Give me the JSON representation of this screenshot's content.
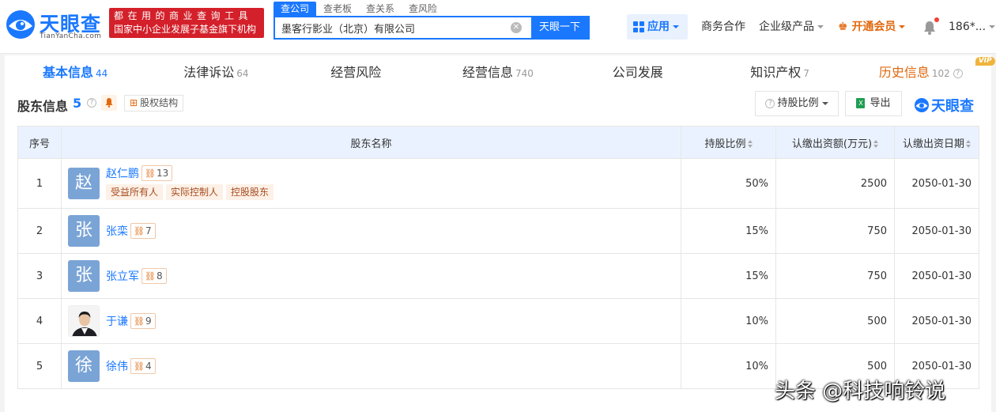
{
  "brand": {
    "name_cn": "天眼查",
    "name_en": "TianYanCha.com",
    "color": "#1a78ff"
  },
  "slogan": {
    "line1": "都在用的商业查询工具",
    "line2": "国家中小企业发展子基金旗下机构"
  },
  "search": {
    "tabs": [
      "查公司",
      "查老板",
      "查关系",
      "查风险"
    ],
    "value": "墨客行影业（北京）有限公司",
    "button": "天眼一下"
  },
  "nav": {
    "apps": "应用",
    "business": "商务合作",
    "enterprise": "企业级产品",
    "vip": "开通会员",
    "user": "186*..."
  },
  "tabs": [
    {
      "label": "基本信息",
      "count": "44"
    },
    {
      "label": "法律诉讼",
      "count": "64"
    },
    {
      "label": "经营风险",
      "count": ""
    },
    {
      "label": "经营信息",
      "count": "740"
    },
    {
      "label": "公司发展",
      "count": ""
    },
    {
      "label": "知识产权",
      "count": "7"
    },
    {
      "label": "历史信息",
      "count": "102",
      "badge": "VIP"
    }
  ],
  "section": {
    "title": "股东信息",
    "count": "5",
    "equity_button": "股权结构",
    "ratio_button": "持股比例",
    "export_button": "导出",
    "watermark_logo": "天眼查"
  },
  "table": {
    "headers": {
      "index": "序号",
      "name": "股东名称",
      "ratio": "持股比例",
      "amount": "认缴出资额(万元)",
      "date": "认缴出资日期"
    },
    "rows": [
      {
        "index": "1",
        "avatar": "赵",
        "name": "赵仁鹏",
        "relations": "13",
        "tags": [
          "受益所有人",
          "实际控制人",
          "控股股东"
        ],
        "ratio": "50%",
        "amount": "2500",
        "date": "2050-01-30"
      },
      {
        "index": "2",
        "avatar": "张",
        "name": "张栾",
        "relations": "7",
        "tags": [],
        "ratio": "15%",
        "amount": "750",
        "date": "2050-01-30"
      },
      {
        "index": "3",
        "avatar": "张",
        "name": "张立军",
        "relations": "8",
        "tags": [],
        "ratio": "15%",
        "amount": "750",
        "date": "2050-01-30"
      },
      {
        "index": "4",
        "avatar": "",
        "name": "于谦",
        "relations": "9",
        "tags": [],
        "ratio": "10%",
        "amount": "500",
        "date": "2050-01-30"
      },
      {
        "index": "5",
        "avatar": "徐",
        "name": "徐伟",
        "relations": "4",
        "tags": [],
        "ratio": "10%",
        "amount": "500",
        "date": "2050-01-30"
      }
    ]
  },
  "watermark": "头条 @科技响铃说"
}
